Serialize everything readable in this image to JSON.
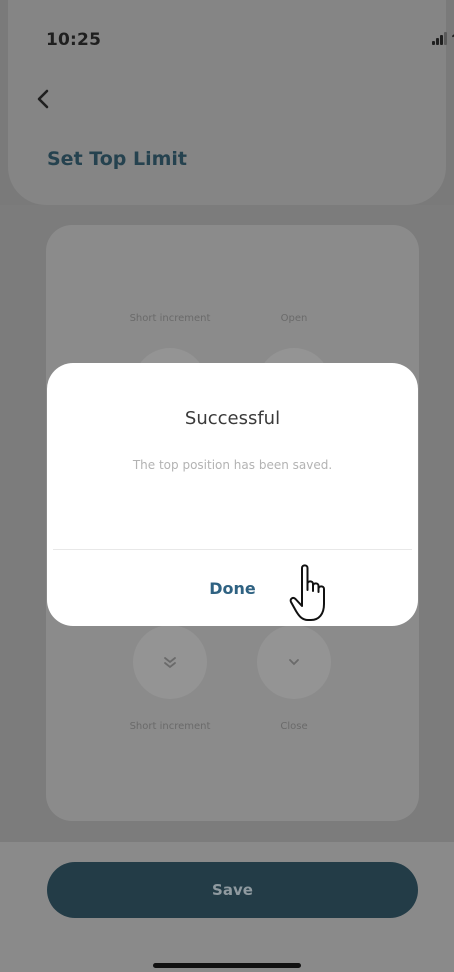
{
  "status_bar": {
    "time": "10:25"
  },
  "header": {
    "title": "Set Top Limit",
    "back_icon": "chevron-left-icon"
  },
  "controls": [
    {
      "label": "Short increment",
      "icon": "double-chevron-up-icon"
    },
    {
      "label": "Open",
      "icon": "chevron-up-icon"
    },
    {
      "label": "Short increment",
      "icon": "double-chevron-down-icon"
    },
    {
      "label": "Close",
      "icon": "chevron-down-icon"
    }
  ],
  "modal": {
    "title": "Successful",
    "message": "The top position has been saved.",
    "done_label": "Done"
  },
  "footer": {
    "save_label": "Save"
  },
  "colors": {
    "accent": "#2f6282",
    "save_button": "#233c47",
    "overlay": "#7a7a7a"
  }
}
